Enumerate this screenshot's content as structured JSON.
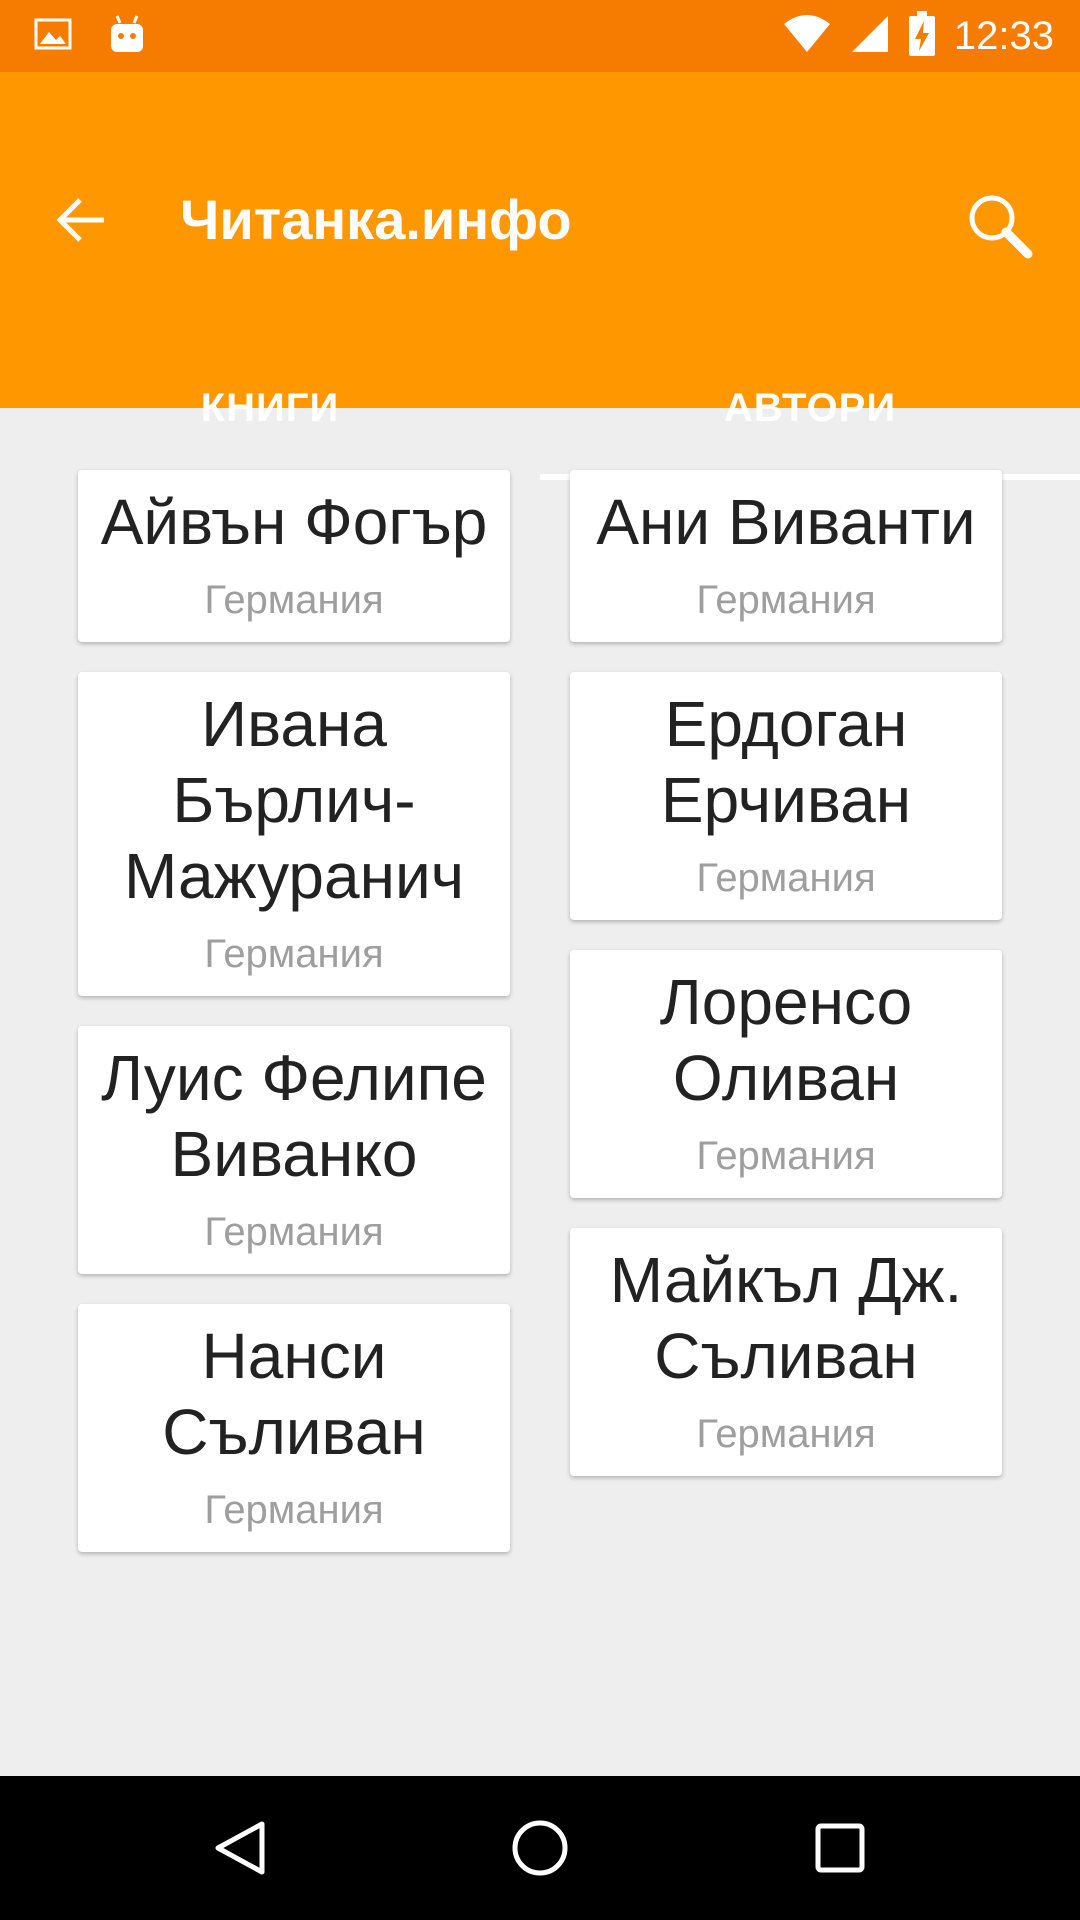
{
  "status_bar": {
    "time": "12:33",
    "icons": [
      "image-icon",
      "android-icon",
      "wifi-icon",
      "signal-icon",
      "battery-charging-icon"
    ]
  },
  "app_bar": {
    "title": "Читанка.инфо",
    "back_icon": "arrow-left-icon",
    "search_icon": "search-icon"
  },
  "tabs": [
    {
      "label": "КНИГИ",
      "active": false
    },
    {
      "label": "АВТОРИ",
      "active": true
    }
  ],
  "authors_left": [
    {
      "name": "Айвън Фогър",
      "country": "Германия"
    },
    {
      "name": "Ивана Бърлич-Мажуранич",
      "country": "Германия"
    },
    {
      "name": "Луис Фелипе Виванко",
      "country": "Германия"
    },
    {
      "name": "Нанси Съливан",
      "country": "Германия"
    }
  ],
  "authors_right": [
    {
      "name": "Ани Виванти",
      "country": "Германия"
    },
    {
      "name": "Ердоган Ерчиван",
      "country": "Германия"
    },
    {
      "name": "Лоренсо Оливан",
      "country": "Германия"
    },
    {
      "name": "Майкъл Дж. Съливан",
      "country": "Германия"
    }
  ],
  "nav_bar": {
    "icons": [
      "back-triangle-icon",
      "home-circle-icon",
      "recents-square-icon"
    ]
  },
  "colors": {
    "status_bar": "#f57c00",
    "app_bar": "#ff9800",
    "background": "#eeeeee"
  }
}
